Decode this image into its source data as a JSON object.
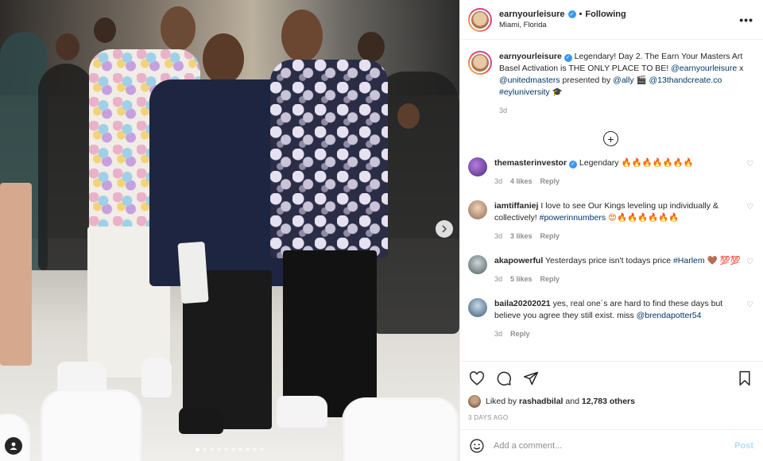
{
  "header": {
    "username": "earnyourleisure",
    "follow_status": "Following",
    "separator": "•",
    "location": "Miami, Florida"
  },
  "caption": {
    "username": "earnyourleisure",
    "text_1": "Legendary! Day 2. The Earn Your Masters Art Basel Activation is THE ONLY PLACE TO BE!",
    "mention_1": "@earnyourleisure",
    "text_2": "x",
    "mention_2": "@unitedmasters",
    "text_3": "presented by",
    "mention_3": "@ally",
    "emoji_clapper": "🎬",
    "mention_4": "@13thandcreate.co",
    "hashtag": "#eyluniversity",
    "emoji_cap": "🎓",
    "age": "3d"
  },
  "comments": [
    {
      "username": "themasterinvestor",
      "verified": true,
      "text": "Legendary",
      "emojis": "🔥🔥🔥🔥🔥🔥🔥",
      "age": "3d",
      "likes": "4 likes",
      "reply": "Reply"
    },
    {
      "username": "iamtiffaniej",
      "verified": false,
      "text": "I love to see Our Kings leveling up individually & collectively!",
      "hashtag": "#powerinnumbers",
      "emojis": "😍🔥🔥🔥🔥🔥🔥",
      "age": "3d",
      "likes": "3 likes",
      "reply": "Reply"
    },
    {
      "username": "akapowerful",
      "verified": false,
      "text": "Yesterdays price isn't todays price",
      "hashtag": "#Harlem",
      "emojis": "🤎 💯💯",
      "age": "3d",
      "likes": "5 likes",
      "reply": "Reply"
    },
    {
      "username": "baila20202021",
      "verified": false,
      "text": "yes, real one´s are hard to find these days but believe you agree they still exist. miss",
      "mention": "@brendapotter54",
      "age": "3d",
      "reply": "Reply"
    }
  ],
  "likes": {
    "prefix": "Liked by",
    "user": "rashadbilal",
    "middle": "and",
    "others": "12,783 others"
  },
  "timestamp": "3 DAYS AGO",
  "add_comment": {
    "placeholder": "Add a comment...",
    "post_label": "Post"
  },
  "icons": {
    "more": "more-options-icon",
    "like": "heart-icon",
    "comment": "comment-icon",
    "share": "paper-plane-icon",
    "save": "bookmark-icon",
    "emoji": "smiley-icon",
    "next": "chevron-right-icon",
    "tag": "user-tag-icon",
    "load": "plus-circle-icon"
  },
  "carousel": {
    "count": 10,
    "active_index": 0
  },
  "colors": {
    "verified": "#3897f0",
    "link": "#00376b",
    "muted": "#8e8e8e",
    "post_button": "#b2dffc"
  }
}
